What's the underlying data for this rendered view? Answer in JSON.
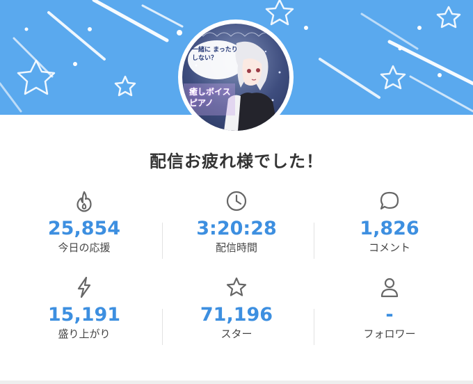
{
  "header": {
    "banner_color": "#5aa9ee",
    "decorations": [
      "star-outline",
      "shooting-star-streak",
      "dot"
    ]
  },
  "avatar": {
    "caption_top": "一緒に まったり しない？",
    "caption_bottom": "癒しボイス ピアノ"
  },
  "title": "配信お疲れ様でした！",
  "stats": [
    {
      "icon": "fire-icon",
      "value": "25,854",
      "label": "今日の応援"
    },
    {
      "icon": "clock-icon",
      "value": "3:20:28",
      "label": "配信時間"
    },
    {
      "icon": "chat-bubble-icon",
      "value": "1,826",
      "label": "コメント"
    },
    {
      "icon": "lightning-icon",
      "value": "15,191",
      "label": "盛り上がり"
    },
    {
      "icon": "star-icon",
      "value": "71,196",
      "label": "スター"
    },
    {
      "icon": "person-icon",
      "value": "-",
      "label": "フォロワー"
    }
  ],
  "colors": {
    "accent": "#3d8fe0",
    "text": "#333333",
    "icon": "#666666"
  }
}
